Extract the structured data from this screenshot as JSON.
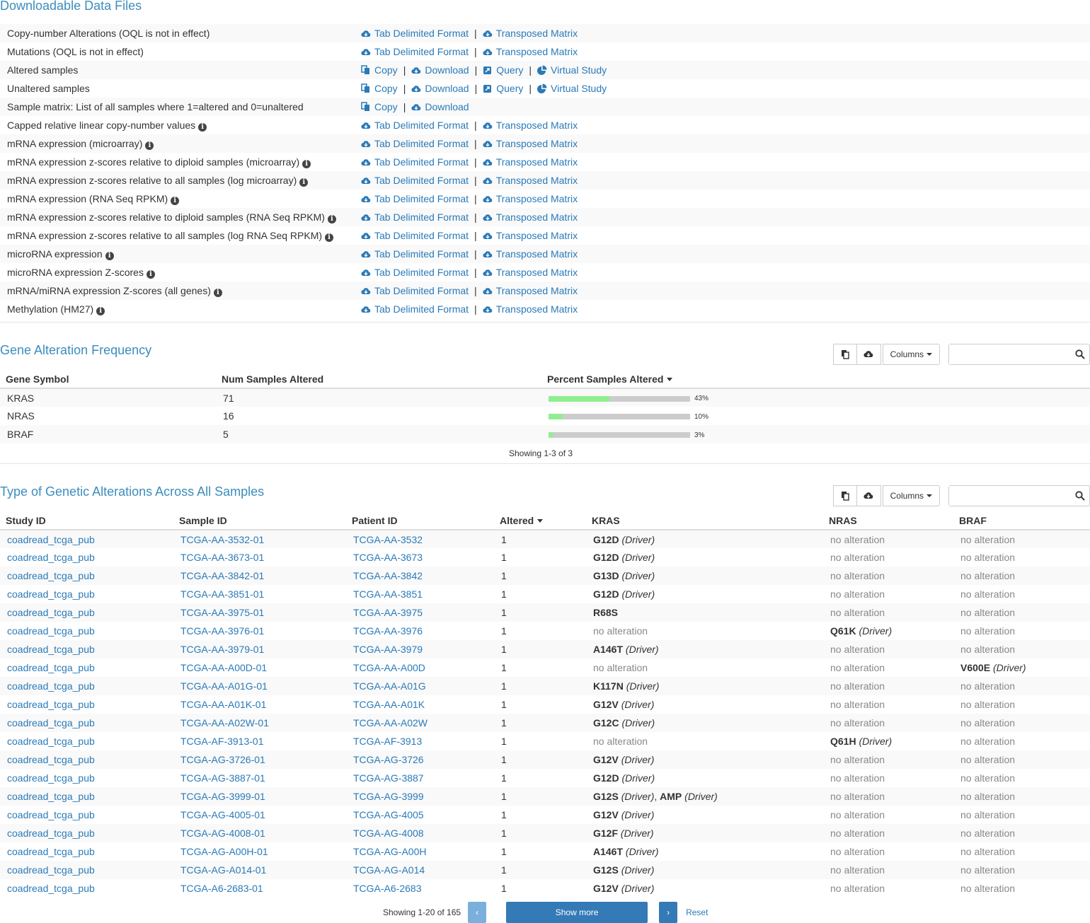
{
  "downloads": {
    "title": "Downloadable Data Files",
    "rows": [
      {
        "label": "Copy-number Alterations (OQL is not in effect)",
        "info": false,
        "type": "tab"
      },
      {
        "label": "Mutations (OQL is not in effect)",
        "info": false,
        "type": "tab"
      },
      {
        "label": "Altered samples",
        "info": false,
        "type": "sample"
      },
      {
        "label": "Unaltered samples",
        "info": false,
        "type": "sample"
      },
      {
        "label": "Sample matrix: List of all samples where 1=altered and 0=unaltered",
        "info": false,
        "type": "matrix"
      },
      {
        "label": "Capped relative linear copy-number values",
        "info": true,
        "type": "tab"
      },
      {
        "label": "mRNA expression (microarray)",
        "info": true,
        "type": "tab"
      },
      {
        "label": "mRNA expression z-scores relative to diploid samples (microarray)",
        "info": true,
        "type": "tab"
      },
      {
        "label": "mRNA expression z-scores relative to all samples (log microarray)",
        "info": true,
        "type": "tab"
      },
      {
        "label": "mRNA expression (RNA Seq RPKM)",
        "info": true,
        "type": "tab"
      },
      {
        "label": "mRNA expression z-scores relative to diploid samples (RNA Seq RPKM)",
        "info": true,
        "type": "tab"
      },
      {
        "label": "mRNA expression z-scores relative to all samples (log RNA Seq RPKM)",
        "info": true,
        "type": "tab"
      },
      {
        "label": "microRNA expression",
        "info": true,
        "type": "tab"
      },
      {
        "label": "microRNA expression Z-scores",
        "info": true,
        "type": "tab"
      },
      {
        "label": "mRNA/miRNA expression Z-scores (all genes)",
        "info": true,
        "type": "tab"
      },
      {
        "label": "Methylation (HM27)",
        "info": true,
        "type": "tab"
      }
    ],
    "links": {
      "tab_delimited": "Tab Delimited Format",
      "transposed": "Transposed Matrix",
      "copy": "Copy",
      "download": "Download",
      "query": "Query",
      "virtual_study": "Virtual Study",
      "separator": "|"
    }
  },
  "gene_freq": {
    "title": "Gene Alteration Frequency",
    "columns": [
      "Gene Symbol",
      "Num Samples Altered",
      "Percent Samples Altered"
    ],
    "rows": [
      {
        "gene": "KRAS",
        "num": "71",
        "pct": 43,
        "pct_label": "43%"
      },
      {
        "gene": "NRAS",
        "num": "16",
        "pct": 10,
        "pct_label": "10%"
      },
      {
        "gene": "BRAF",
        "num": "5",
        "pct": 3,
        "pct_label": "3%"
      }
    ],
    "showing": "Showing 1-3 of 3",
    "columns_btn": "Columns"
  },
  "alterations": {
    "title": "Type of Genetic Alterations Across All Samples",
    "columns": [
      "Study ID",
      "Sample ID",
      "Patient ID",
      "Altered",
      "KRAS",
      "NRAS",
      "BRAF"
    ],
    "columns_btn": "Columns",
    "no_alteration": "no alteration",
    "driver": "(Driver)",
    "rows": [
      {
        "study": "coadread_tcga_pub",
        "sample": "TCGA-AA-3532-01",
        "patient": "TCGA-AA-3532",
        "altered": "1",
        "kras": [
          {
            "m": "G12D",
            "d": true
          }
        ],
        "nras": null,
        "braf": null
      },
      {
        "study": "coadread_tcga_pub",
        "sample": "TCGA-AA-3673-01",
        "patient": "TCGA-AA-3673",
        "altered": "1",
        "kras": [
          {
            "m": "G12D",
            "d": true
          }
        ],
        "nras": null,
        "braf": null
      },
      {
        "study": "coadread_tcga_pub",
        "sample": "TCGA-AA-3842-01",
        "patient": "TCGA-AA-3842",
        "altered": "1",
        "kras": [
          {
            "m": "G13D",
            "d": true
          }
        ],
        "nras": null,
        "braf": null
      },
      {
        "study": "coadread_tcga_pub",
        "sample": "TCGA-AA-3851-01",
        "patient": "TCGA-AA-3851",
        "altered": "1",
        "kras": [
          {
            "m": "G12D",
            "d": true
          }
        ],
        "nras": null,
        "braf": null
      },
      {
        "study": "coadread_tcga_pub",
        "sample": "TCGA-AA-3975-01",
        "patient": "TCGA-AA-3975",
        "altered": "1",
        "kras": [
          {
            "m": "R68S",
            "d": false
          }
        ],
        "nras": null,
        "braf": null
      },
      {
        "study": "coadread_tcga_pub",
        "sample": "TCGA-AA-3976-01",
        "patient": "TCGA-AA-3976",
        "altered": "1",
        "kras": null,
        "nras": [
          {
            "m": "Q61K",
            "d": true
          }
        ],
        "braf": null
      },
      {
        "study": "coadread_tcga_pub",
        "sample": "TCGA-AA-3979-01",
        "patient": "TCGA-AA-3979",
        "altered": "1",
        "kras": [
          {
            "m": "A146T",
            "d": true
          }
        ],
        "nras": null,
        "braf": null
      },
      {
        "study": "coadread_tcga_pub",
        "sample": "TCGA-AA-A00D-01",
        "patient": "TCGA-AA-A00D",
        "altered": "1",
        "kras": null,
        "nras": null,
        "braf": [
          {
            "m": "V600E",
            "d": true
          }
        ]
      },
      {
        "study": "coadread_tcga_pub",
        "sample": "TCGA-AA-A01G-01",
        "patient": "TCGA-AA-A01G",
        "altered": "1",
        "kras": [
          {
            "m": "K117N",
            "d": true
          }
        ],
        "nras": null,
        "braf": null
      },
      {
        "study": "coadread_tcga_pub",
        "sample": "TCGA-AA-A01K-01",
        "patient": "TCGA-AA-A01K",
        "altered": "1",
        "kras": [
          {
            "m": "G12V",
            "d": true
          }
        ],
        "nras": null,
        "braf": null
      },
      {
        "study": "coadread_tcga_pub",
        "sample": "TCGA-AA-A02W-01",
        "patient": "TCGA-AA-A02W",
        "altered": "1",
        "kras": [
          {
            "m": "G12C",
            "d": true
          }
        ],
        "nras": null,
        "braf": null
      },
      {
        "study": "coadread_tcga_pub",
        "sample": "TCGA-AF-3913-01",
        "patient": "TCGA-AF-3913",
        "altered": "1",
        "kras": null,
        "nras": [
          {
            "m": "Q61H",
            "d": true
          }
        ],
        "braf": null
      },
      {
        "study": "coadread_tcga_pub",
        "sample": "TCGA-AG-3726-01",
        "patient": "TCGA-AG-3726",
        "altered": "1",
        "kras": [
          {
            "m": "G12V",
            "d": true
          }
        ],
        "nras": null,
        "braf": null
      },
      {
        "study": "coadread_tcga_pub",
        "sample": "TCGA-AG-3887-01",
        "patient": "TCGA-AG-3887",
        "altered": "1",
        "kras": [
          {
            "m": "G12D",
            "d": true
          }
        ],
        "nras": null,
        "braf": null
      },
      {
        "study": "coadread_tcga_pub",
        "sample": "TCGA-AG-3999-01",
        "patient": "TCGA-AG-3999",
        "altered": "1",
        "kras": [
          {
            "m": "G12S",
            "d": true
          },
          {
            "m": "AMP",
            "d": true
          }
        ],
        "nras": null,
        "braf": null
      },
      {
        "study": "coadread_tcga_pub",
        "sample": "TCGA-AG-4005-01",
        "patient": "TCGA-AG-4005",
        "altered": "1",
        "kras": [
          {
            "m": "G12V",
            "d": true
          }
        ],
        "nras": null,
        "braf": null
      },
      {
        "study": "coadread_tcga_pub",
        "sample": "TCGA-AG-4008-01",
        "patient": "TCGA-AG-4008",
        "altered": "1",
        "kras": [
          {
            "m": "G12F",
            "d": true
          }
        ],
        "nras": null,
        "braf": null
      },
      {
        "study": "coadread_tcga_pub",
        "sample": "TCGA-AG-A00H-01",
        "patient": "TCGA-AG-A00H",
        "altered": "1",
        "kras": [
          {
            "m": "A146T",
            "d": true
          }
        ],
        "nras": null,
        "braf": null
      },
      {
        "study": "coadread_tcga_pub",
        "sample": "TCGA-AG-A014-01",
        "patient": "TCGA-AG-A014",
        "altered": "1",
        "kras": [
          {
            "m": "G12S",
            "d": true
          }
        ],
        "nras": null,
        "braf": null
      },
      {
        "study": "coadread_tcga_pub",
        "sample": "TCGA-A6-2683-01",
        "patient": "TCGA-A6-2683",
        "altered": "1",
        "kras": [
          {
            "m": "G12V",
            "d": true
          }
        ],
        "nras": null,
        "braf": null
      }
    ],
    "showing": "Showing 1-20 of 165",
    "show_more": "Show more",
    "reset": "Reset"
  },
  "colors": {
    "link": "#2a7ab8",
    "title": "#3c8dbc",
    "bar_fill": "#90ee90",
    "bar_bg": "#cccccc",
    "button": "#337ab7"
  }
}
